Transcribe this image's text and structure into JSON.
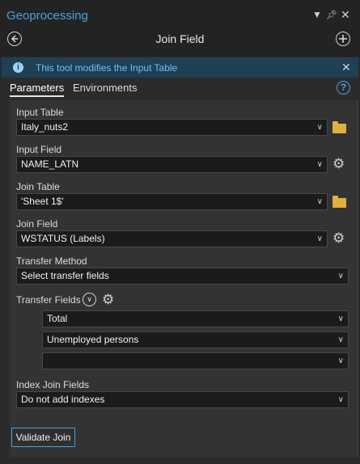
{
  "pane": {
    "title": "Geoprocessing"
  },
  "tool": {
    "title": "Join Field"
  },
  "info": {
    "message": "This tool modifies the Input Table"
  },
  "tabs": {
    "parameters": "Parameters",
    "environments": "Environments"
  },
  "params": {
    "input_table": {
      "label": "Input Table",
      "value": "Italy_nuts2"
    },
    "input_field": {
      "label": "Input Field",
      "value": "NAME_LATN"
    },
    "join_table": {
      "label": "Join Table",
      "value": "'Sheet 1$'"
    },
    "join_field": {
      "label": "Join Field",
      "value": "WSTATUS (Labels)"
    },
    "transfer_method": {
      "label": "Transfer Method",
      "value": "Select transfer fields"
    },
    "transfer_fields": {
      "label": "Transfer Fields",
      "values": [
        "Total",
        "Unemployed persons",
        ""
      ]
    },
    "index_join_fields": {
      "label": "Index Join Fields",
      "value": "Do not add indexes"
    }
  },
  "buttons": {
    "validate": "Validate Join"
  },
  "icons": [
    "menu-icon",
    "pin-icon",
    "close-icon",
    "back-icon",
    "add-icon",
    "info-icon",
    "help-icon",
    "folder-icon",
    "gear-icon",
    "chevron-down-icon",
    "expand-icon"
  ],
  "colors": {
    "accent": "#4aa3df",
    "info_bg": "#1f3f55",
    "background": "#2b2b2b",
    "field_bg": "#1b1b1b"
  }
}
